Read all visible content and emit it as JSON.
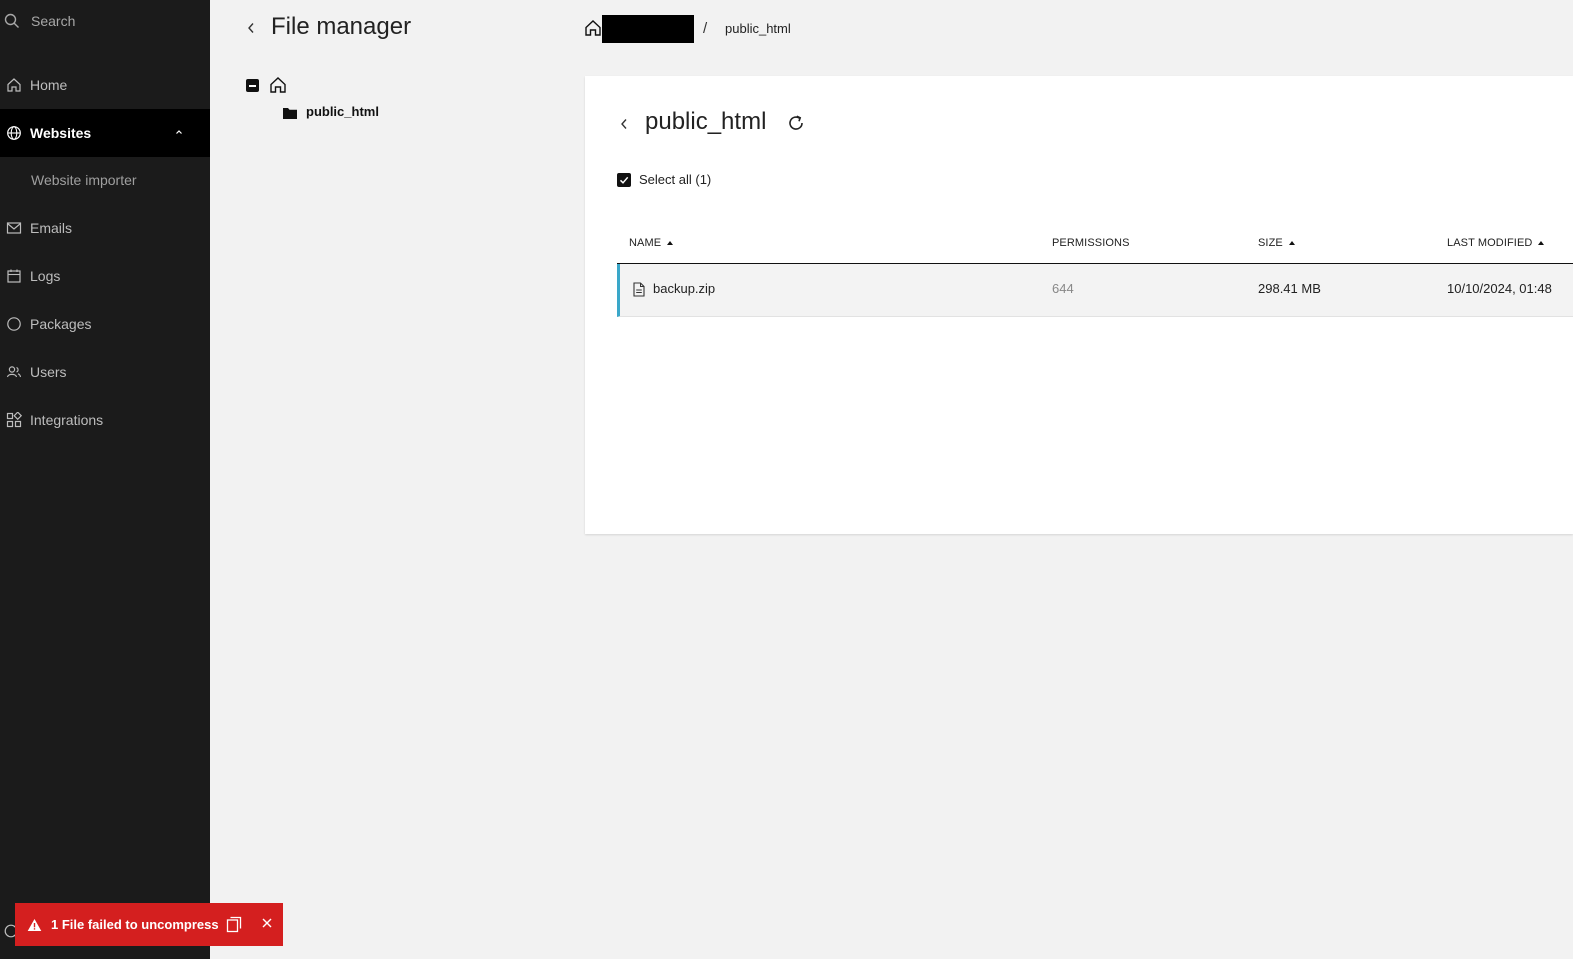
{
  "sidebar": {
    "search_label": "Search",
    "items": [
      {
        "label": "Home",
        "icon": "home-icon"
      },
      {
        "label": "Websites",
        "icon": "globe-icon"
      },
      {
        "label": "Emails",
        "icon": "mail-icon"
      },
      {
        "label": "Logs",
        "icon": "calendar-icon"
      },
      {
        "label": "Packages",
        "icon": "circle-icon"
      },
      {
        "label": "Users",
        "icon": "users-icon"
      },
      {
        "label": "Integrations",
        "icon": "integrations-icon"
      }
    ],
    "sub_items": [
      "Website importer"
    ],
    "active_item": "Websites"
  },
  "header": {
    "title": "File manager"
  },
  "tree": {
    "folder": "public_html"
  },
  "breadcrumb": {
    "separator": "/",
    "current": "public_html"
  },
  "panel": {
    "title": "public_html",
    "select_all": "Select all (1)",
    "columns": {
      "name": "NAME",
      "permissions": "PERMISSIONS",
      "size": "SIZE",
      "last_modified": "LAST MODIFIED"
    },
    "rows": [
      {
        "name": "backup.zip",
        "permissions": "644",
        "size": "298.41 MB",
        "last_modified": "10/10/2024, 01:48"
      }
    ]
  },
  "toast": {
    "message": "1 File failed to uncompress",
    "color": "#d41f1f"
  },
  "colors": {
    "sidebar_bg": "#1b1b1b",
    "active_bg": "#000000",
    "row_accent": "#3aa7c9"
  }
}
